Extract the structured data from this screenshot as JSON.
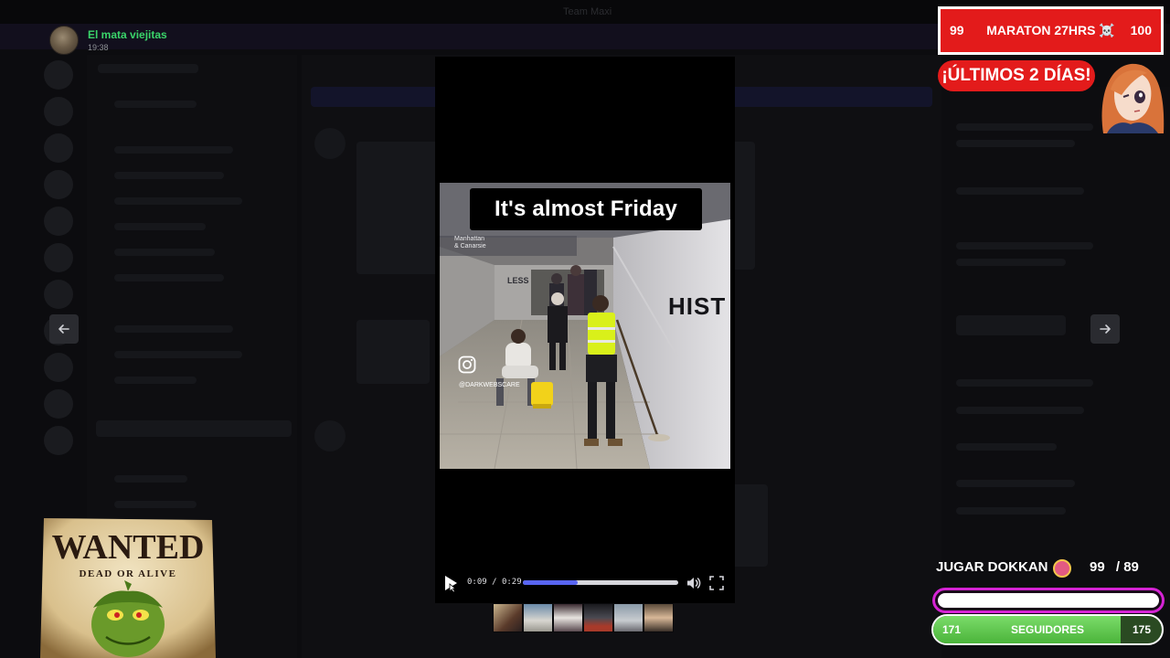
{
  "uploader": {
    "name": "El mata viejitas",
    "time": "19:38"
  },
  "media": {
    "caption": "It's almost Friday",
    "station_tag_line1": "Manhattan",
    "station_tag_line2": "& Canarsie",
    "wall_sign": "HIST",
    "wall_sign_small": "LESS",
    "instagram_handle": "@DARKWEBSCARE",
    "current_time": "0:09",
    "duration": "0:29",
    "time_separator": " / ",
    "progress": 0.35
  },
  "overlay": {
    "marathon_left": "99",
    "marathon_title": "MARATON 27HRS ☠️",
    "marathon_right": "100",
    "last_days": "¡ÚLTIMOS 2 DÍAS!",
    "goal_label": "JUGAR DOKKAN",
    "goal_current": "99",
    "goal_sep": "/",
    "goal_target": "89",
    "goal_fill": 1.0,
    "followers_label": "SEGUIDORES",
    "followers_start": "171",
    "followers_end": "175",
    "followers_fill": 0.82
  },
  "wanted_poster": {
    "title": "WANTED",
    "subtitle": "DEAD OR ALIVE"
  },
  "icons": {
    "prev": "arrow-left-icon",
    "next": "arrow-right-icon",
    "play": "play-icon",
    "volume": "volume-icon",
    "fullscreen": "fullscreen-icon",
    "instagram": "instagram-icon"
  },
  "colors": {
    "accent": "#5865f2",
    "uploader_name": "#3ad46a",
    "marathon_red": "#e31b1b",
    "goal_border": "#d523d4",
    "followers_green": "#4bb43a"
  }
}
